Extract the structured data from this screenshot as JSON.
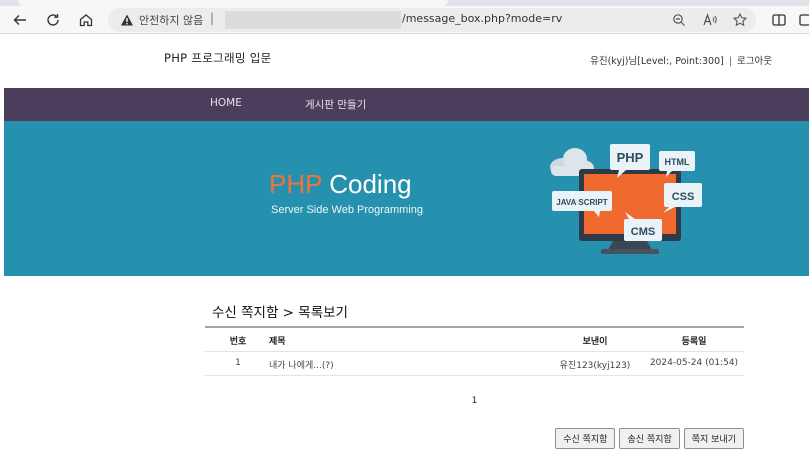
{
  "browser": {
    "security_label": "안전하지 않음",
    "separator": "|",
    "url": "/message_box.php?mode=rv",
    "icons": [
      "back-arrow-icon",
      "reload-icon",
      "home-icon",
      "warning-icon",
      "zoom-icon",
      "read-aloud-icon",
      "favorite-star-icon",
      "split-screen-icon",
      "sidebar-icon"
    ]
  },
  "header": {
    "site_title": "PHP 프로그래밍 입문",
    "user_info": "유진(kyj)님[Level:, Point:300]",
    "divider": "|",
    "logout": "로그아웃"
  },
  "nav": {
    "items": [
      "HOME",
      "게시판 만들기"
    ]
  },
  "banner": {
    "title_highlight": "PHP",
    "title_rest": " Coding",
    "subtitle": "Server Side Web Programming",
    "art_labels": {
      "php": "PHP",
      "html": "HTML",
      "css": "CSS",
      "javascript": "JAVA SCRIPT",
      "cms": "CMS"
    },
    "colors": {
      "background": "#2591ae",
      "accent": "#f2733a"
    }
  },
  "main": {
    "breadcrumb": "수신 쪽지함 > 목록보기",
    "table": {
      "headers": {
        "num": "번호",
        "subject": "제목",
        "from": "보낸이",
        "date": "등록일"
      },
      "rows": [
        {
          "num": "1",
          "subject": "내가 나에게...(?)",
          "from": "유진123(kyj123)",
          "date": "2024-05-24 (01:54)"
        }
      ]
    },
    "pager": "1",
    "buttons": {
      "inbox": "수신 쪽지함",
      "outbox": "송신 쪽지함",
      "send": "쪽지 보내기"
    }
  }
}
